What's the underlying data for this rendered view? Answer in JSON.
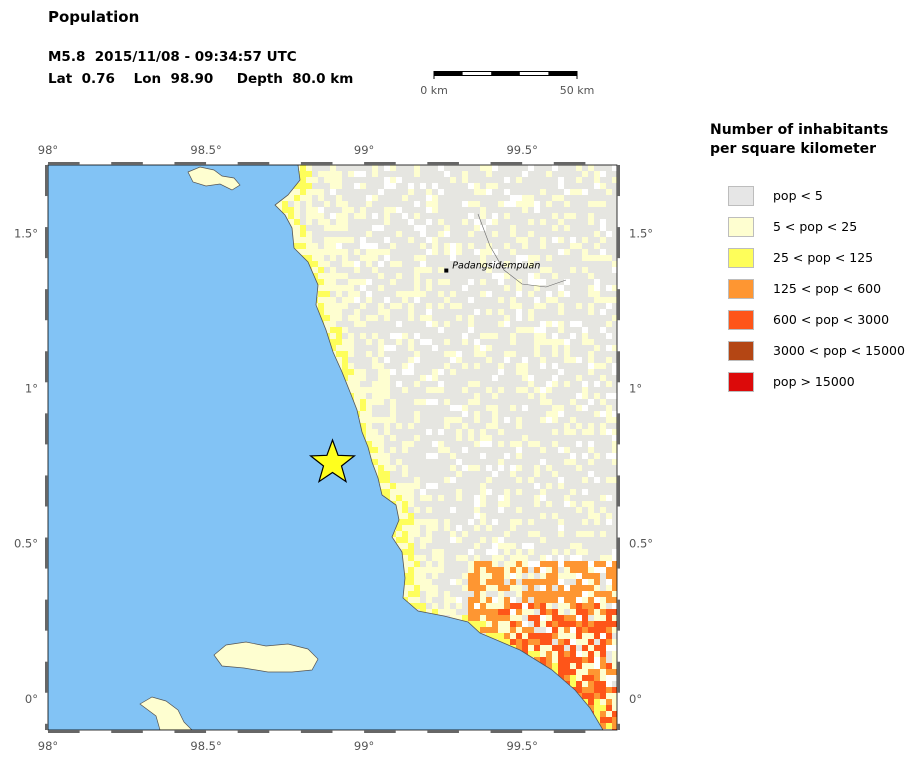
{
  "header": {
    "title": "Population",
    "event_line": "M5.8  2015/11/08 - 09:34:57 UTC",
    "location_line": "Lat  0.76    Lon  98.90     Depth  80.0 km"
  },
  "scale_bar": {
    "left_label": "0 km",
    "right_label": "50 km",
    "length_km": 50
  },
  "map": {
    "lon_range": [
      98.0,
      99.8
    ],
    "lat_range": [
      -0.1,
      1.72
    ],
    "x_ticks": [
      {
        "value": 98.0,
        "label": "98°"
      },
      {
        "value": 98.5,
        "label": "98.5°"
      },
      {
        "value": 99.0,
        "label": "99°"
      },
      {
        "value": 99.5,
        "label": "99.5°"
      }
    ],
    "y_ticks": [
      {
        "value": 1.5,
        "label": "1.5°"
      },
      {
        "value": 1.0,
        "label": "1°"
      },
      {
        "value": 0.5,
        "label": "0.5°"
      },
      {
        "value": 0.0,
        "label": "0°"
      }
    ],
    "epicenter": {
      "lon": 98.9,
      "lat": 0.76
    },
    "city": {
      "name": "Padangsidempuan",
      "lon": 99.26,
      "lat": 1.38
    },
    "colors": {
      "ocean": "#82c3f5",
      "land_base": "#e6e6e1",
      "coast": "#555555",
      "star": "#ffff1e"
    }
  },
  "legend": {
    "title_line1": "Number of inhabitants",
    "title_line2": "per square kilometer",
    "items": [
      {
        "label": "pop < 5",
        "color": "#e6e6e6"
      },
      {
        "label": "5 < pop < 25",
        "color": "#fefed0"
      },
      {
        "label": "25 < pop < 125",
        "color": "#fefe5a"
      },
      {
        "label": "125 < pop < 600",
        "color": "#fe9632"
      },
      {
        "label": "600 < pop < 3000",
        "color": "#fe5519"
      },
      {
        "label": "3000 < pop < 15000",
        "color": "#b44614"
      },
      {
        "label": "pop > 15000",
        "color": "#dc0a0a"
      }
    ]
  }
}
